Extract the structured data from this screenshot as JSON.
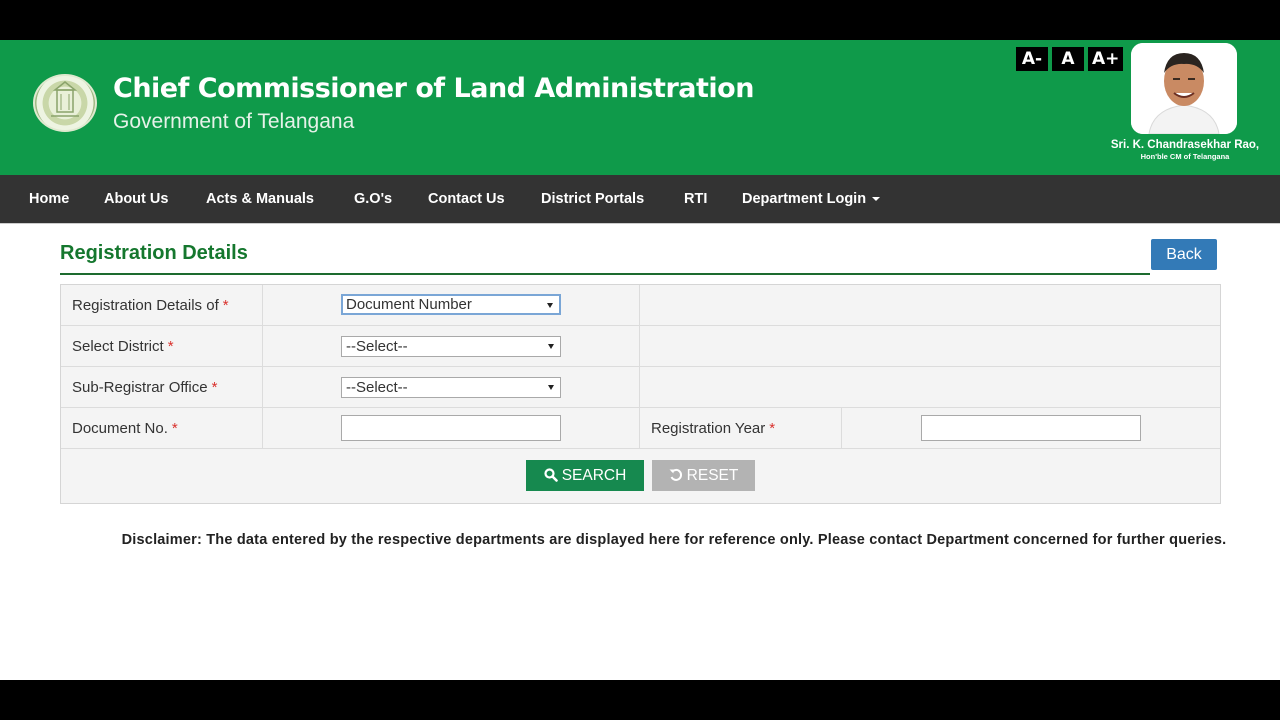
{
  "header": {
    "title": "Chief Commissioner of Land Administration",
    "subtitle": "Government of Telangana",
    "font_buttons": [
      "A-",
      "A",
      "A+"
    ],
    "cm_name": "Sri. K. Chandrasekhar Rao,",
    "cm_title": "Hon'ble CM of Telangana",
    "brand_color": "#0f9a4a"
  },
  "nav": {
    "items": [
      "Home",
      "About Us",
      "Acts & Manuals",
      "G.O's",
      "Contact Us",
      "District Portals",
      "RTI",
      "Department Login"
    ]
  },
  "page": {
    "title": "Registration Details",
    "back_label": "Back"
  },
  "form": {
    "registration_details_of": {
      "label": "Registration Details of",
      "required": "*",
      "value": "Document Number"
    },
    "district": {
      "label": "Select District",
      "required": "*",
      "value": "--Select--"
    },
    "sro": {
      "label": "Sub-Registrar Office",
      "required": "*",
      "value": "--Select--"
    },
    "document_no": {
      "label": "Document No.",
      "required": "*",
      "value": ""
    },
    "registration_year": {
      "label": "Registration Year",
      "required": "*",
      "value": ""
    },
    "search_label": "SEARCH",
    "reset_label": "RESET",
    "search_icon": "search-icon",
    "reset_icon": "undo-icon"
  },
  "disclaimer": "Disclaimer:  The data entered by the respective departments are displayed here for reference only. Please contact Department concerned for further queries."
}
